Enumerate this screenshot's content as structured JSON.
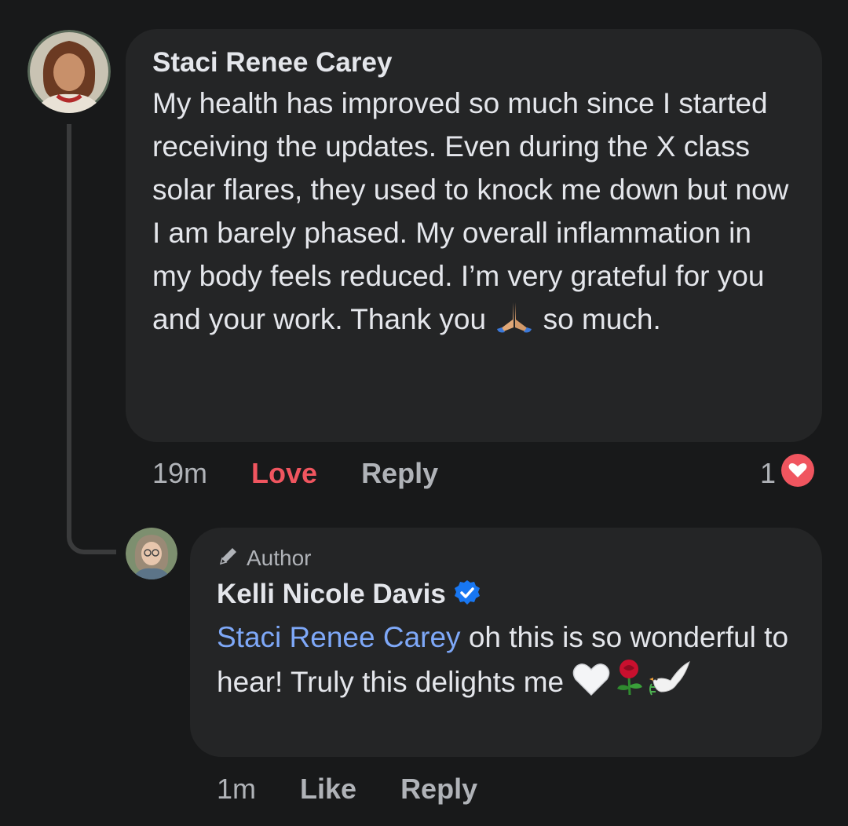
{
  "comment": {
    "author": "Staci Renee Carey",
    "text_before_emoji": "My health has improved so much since I started receiving the updates. Even during the X class solar flares, they used to knock me down but now I am barely phased. My overall inflammation in my body feels reduced. I’m very grateful for you and your work. Thank you ",
    "text_after_emoji": " so much.",
    "emoji": "folded-hands",
    "time": "19m",
    "reaction_label": "Love",
    "reply_label": "Reply",
    "reaction_count": "1",
    "reaction_icon": "heart-reaction-icon",
    "accent_color": "#f0555f"
  },
  "reply": {
    "badge": "Author",
    "author": "Kelli Nicole Davis",
    "verified": true,
    "mention": "Staci Renee Carey",
    "text": " oh this is so wonderful to hear! Truly this delights me ",
    "emojis": [
      "white-heart",
      "rose",
      "dove"
    ],
    "time": "1m",
    "like_label": "Like",
    "reply_label": "Reply",
    "mention_color": "#7ea8f8"
  }
}
